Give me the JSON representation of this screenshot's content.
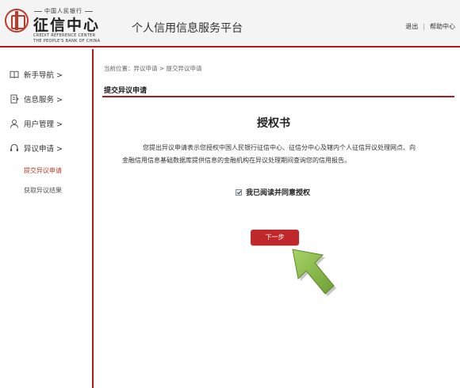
{
  "header": {
    "logo_top": "中国人民银行",
    "logo_main": "征信中心",
    "logo_sub1": "CREDIT REFERENCE CENTER",
    "logo_sub2": "THE PEOPLE'S BANK OF CHINA",
    "platform_title": "个人信用信息服务平台",
    "logout_label": "退出",
    "separator": "|",
    "help_label": "帮助中心"
  },
  "sidebar": {
    "items": [
      {
        "label": "新手导航 >",
        "icon": "book-icon"
      },
      {
        "label": "信息服务 >",
        "icon": "document-icon"
      },
      {
        "label": "用户管理 >",
        "icon": "user-icon"
      },
      {
        "label": "异议申请 >",
        "icon": "headset-icon"
      }
    ],
    "sub_items": [
      {
        "label": "提交异议申请",
        "active": true
      },
      {
        "label": "获取异议结果",
        "active": false
      }
    ]
  },
  "main": {
    "breadcrumb": "当前位置：异议申请 > 提交异议申请",
    "section_title": "提交异议申请",
    "doc_title": "授权书",
    "doc_body": "您提出异议申请表示您授权中国人民银行征信中心、征信分中心及辖内个人征信异议处理网点、向金融信用信息基础数据库提供信息的金融机构在异议处理期间查询您的信用报告。",
    "agree_label": "我已阅读并同意授权",
    "agree_checked": true,
    "next_button": "下一步"
  },
  "colors": {
    "brand_red": "#b01c1c",
    "button_red": "#c0282b",
    "active_link": "#c0392b",
    "arrow_green": "#8bbd4a"
  }
}
